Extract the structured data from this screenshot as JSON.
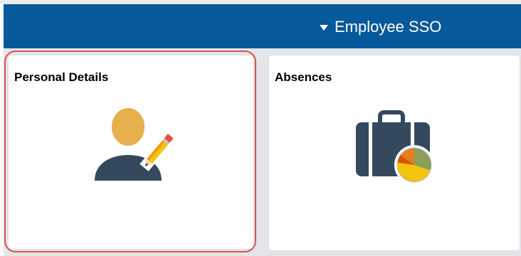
{
  "header": {
    "title": "Employee SSO"
  },
  "tiles": [
    {
      "title": "Personal Details",
      "icon": "person-edit-icon"
    },
    {
      "title": "Absences",
      "icon": "briefcase-pie-icon"
    }
  ],
  "colors": {
    "header_bg": "#06599a",
    "highlight": "#d9534f"
  }
}
